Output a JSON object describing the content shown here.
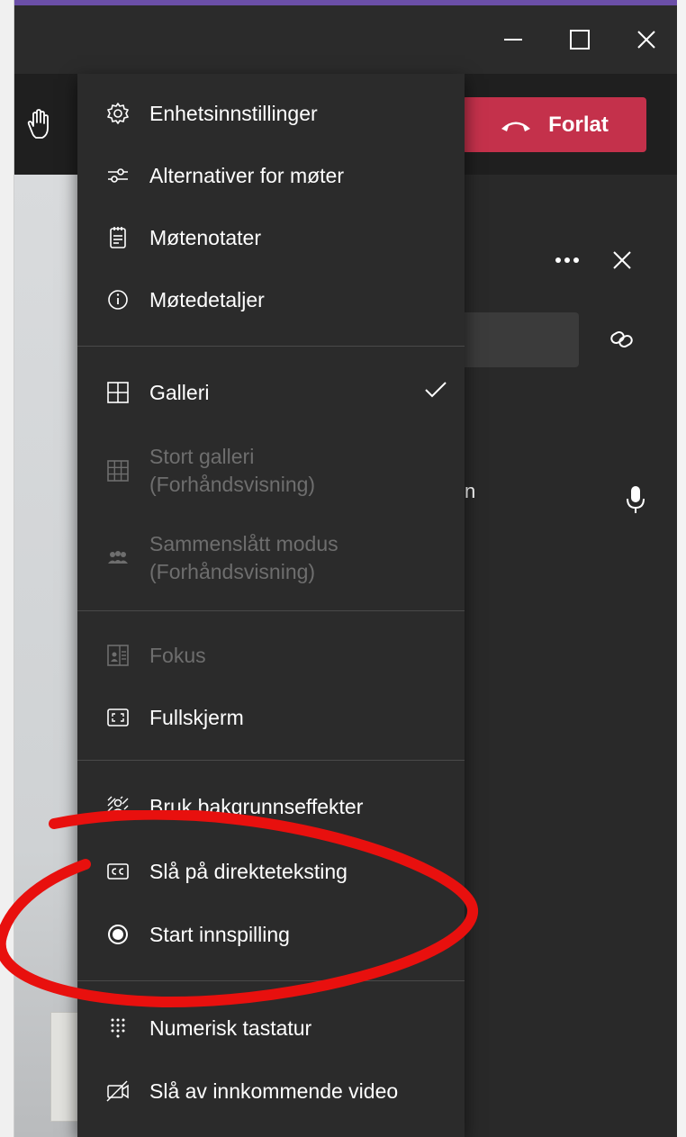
{
  "window": {
    "minimize_icon": "minimize-icon",
    "maximize_icon": "maximize-icon",
    "close_icon": "close-icon"
  },
  "toolbar": {
    "leave_label": "Forlat",
    "raise_hand_icon": "raise-hand-icon"
  },
  "panel": {
    "partial_name": "n"
  },
  "menu": {
    "items": [
      {
        "label": "Enhetsinnstillinger",
        "icon": "gear-icon"
      },
      {
        "label": "Alternativer for møter",
        "icon": "sliders-icon"
      },
      {
        "label": "Møtenotater",
        "icon": "notes-icon"
      },
      {
        "label": "Møtedetaljer",
        "icon": "info-icon"
      },
      {
        "label": "Galleri",
        "icon": "gallery-icon",
        "checked": true
      },
      {
        "label": "Stort galleri",
        "label2": "(Forhåndsvisning)",
        "icon": "large-gallery-icon",
        "disabled": true
      },
      {
        "label": "Sammenslått modus",
        "label2": "(Forhåndsvisning)",
        "icon": "together-mode-icon",
        "disabled": true
      },
      {
        "label": "Fokus",
        "icon": "focus-icon",
        "disabled": true
      },
      {
        "label": "Fullskjerm",
        "icon": "fullscreen-icon"
      },
      {
        "label": "Bruk bakgrunnseffekter",
        "icon": "background-effects-icon"
      },
      {
        "label": "Slå på direkteteksting",
        "icon": "captions-icon"
      },
      {
        "label": "Start innspilling",
        "icon": "record-icon"
      },
      {
        "label": "Numerisk tastatur",
        "icon": "dialpad-icon"
      },
      {
        "label": "Slå av innkommende video",
        "icon": "video-off-icon"
      }
    ]
  },
  "annotation": {
    "color": "#e8100e"
  },
  "colors": {
    "leave": "#c4314b",
    "menu_bg": "#2b2b2b",
    "panel_bg": "#292929"
  }
}
